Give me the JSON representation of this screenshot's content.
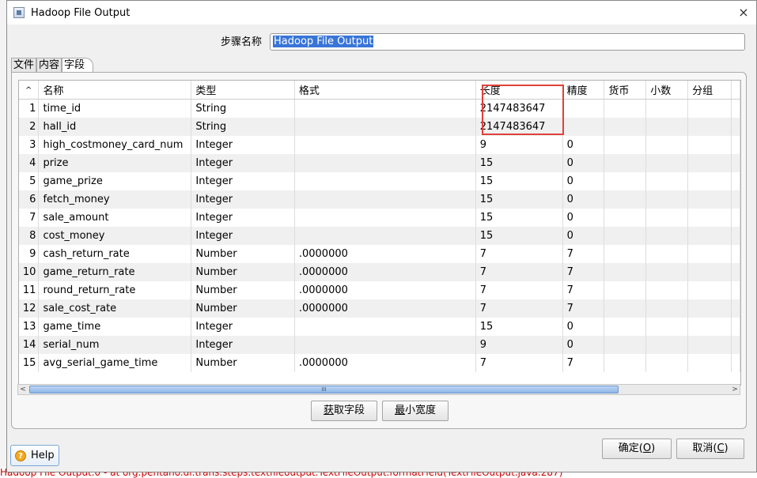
{
  "window": {
    "title": "Hadoop File Output",
    "close_glyph": "×"
  },
  "step": {
    "label": "步骤名称",
    "value": "Hadoop File Output"
  },
  "tabs": [
    {
      "label": "文件"
    },
    {
      "label": "内容"
    },
    {
      "label": "字段"
    }
  ],
  "active_tab": "字段",
  "table": {
    "sort_indicator": "^",
    "columns": [
      "名称",
      "类型",
      "格式",
      "长度",
      "精度",
      "货币",
      "小数",
      "分组"
    ],
    "rows": [
      {
        "n": "1",
        "name": "time_id",
        "type": "String",
        "format": "",
        "length": "2147483647",
        "precision": ""
      },
      {
        "n": "2",
        "name": "hall_id",
        "type": "String",
        "format": "",
        "length": "2147483647",
        "precision": ""
      },
      {
        "n": "3",
        "name": "high_costmoney_card_num",
        "type": "Integer",
        "format": "",
        "length": "9",
        "precision": "0"
      },
      {
        "n": "4",
        "name": "prize",
        "type": "Integer",
        "format": "",
        "length": "15",
        "precision": "0"
      },
      {
        "n": "5",
        "name": "game_prize",
        "type": "Integer",
        "format": "",
        "length": "15",
        "precision": "0"
      },
      {
        "n": "6",
        "name": "fetch_money",
        "type": "Integer",
        "format": "",
        "length": "15",
        "precision": "0"
      },
      {
        "n": "7",
        "name": "sale_amount",
        "type": "Integer",
        "format": "",
        "length": "15",
        "precision": "0"
      },
      {
        "n": "8",
        "name": "cost_money",
        "type": "Integer",
        "format": "",
        "length": "15",
        "precision": "0"
      },
      {
        "n": "9",
        "name": "cash_return_rate",
        "type": "Number",
        "format": ".0000000",
        "length": "7",
        "precision": "7"
      },
      {
        "n": "10",
        "name": "game_return_rate",
        "type": "Number",
        "format": ".0000000",
        "length": "7",
        "precision": "7"
      },
      {
        "n": "11",
        "name": "round_return_rate",
        "type": "Number",
        "format": ".0000000",
        "length": "7",
        "precision": "7"
      },
      {
        "n": "12",
        "name": "sale_cost_rate",
        "type": "Number",
        "format": ".0000000",
        "length": "7",
        "precision": "7"
      },
      {
        "n": "13",
        "name": "game_time",
        "type": "Integer",
        "format": "",
        "length": "15",
        "precision": "0"
      },
      {
        "n": "14",
        "name": "serial_num",
        "type": "Integer",
        "format": "",
        "length": "9",
        "precision": "0"
      },
      {
        "n": "15",
        "name": "avg_serial_game_time",
        "type": "Number",
        "format": ".0000000",
        "length": "7",
        "precision": "7"
      }
    ]
  },
  "buttons": {
    "get_fields_key": "获",
    "get_fields_rest": "取字段",
    "min_width_key": "最",
    "min_width_rest": "小宽度",
    "ok_label": "确定(",
    "ok_key": "O",
    "ok_end": ")",
    "cancel_label": "取消(",
    "cancel_key": "C",
    "cancel_end": ")",
    "help": "Help"
  },
  "scrollbar": {
    "left_arrow": "<",
    "right_arrow": ">",
    "grip": "III"
  },
  "background_log": "Hadoop File Output.0 - at org.pentaho.di.trans.steps.textfileoutput.TextFileOutput.formatField(TextFileOutput.java:287)",
  "colors": {
    "highlight_box": "#e0413a",
    "selection": "#3875d7"
  }
}
